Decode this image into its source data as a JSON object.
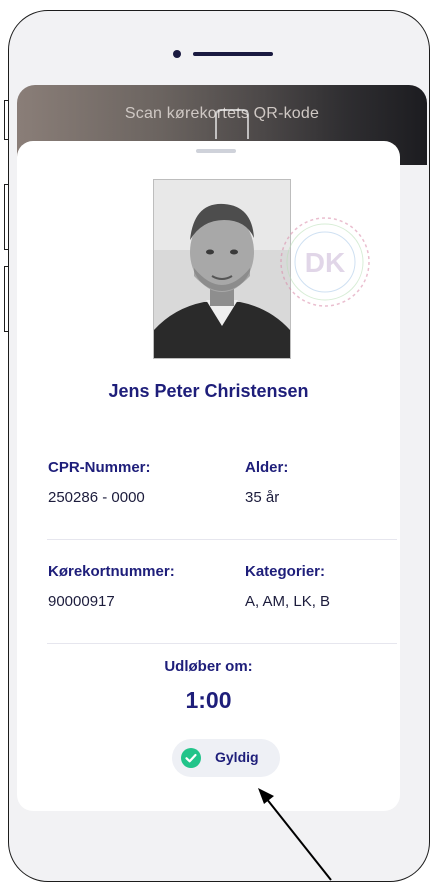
{
  "scan_banner": {
    "title": "Scan kørekortets QR-kode"
  },
  "profile": {
    "name": "Jens Peter Christensen",
    "photo_alt": "Portrait photo",
    "seal_text": "DK"
  },
  "fields": {
    "cpr_label": "CPR-Nummer:",
    "cpr_value": "250286 - 0000",
    "age_label": "Alder:",
    "age_value": "35 år",
    "license_label": "Kørekortnummer:",
    "license_value": "90000917",
    "categories_label": "Kategorier:",
    "categories_value": "A, AM, LK, B"
  },
  "expiry": {
    "label": "Udløber om:",
    "time": "1:00"
  },
  "status": {
    "label": "Gyldig",
    "color": "#22c48a"
  },
  "colors": {
    "accent": "#1e1e7a",
    "card_bg": "#ffffff",
    "phone_bg": "#f2f2f4"
  }
}
